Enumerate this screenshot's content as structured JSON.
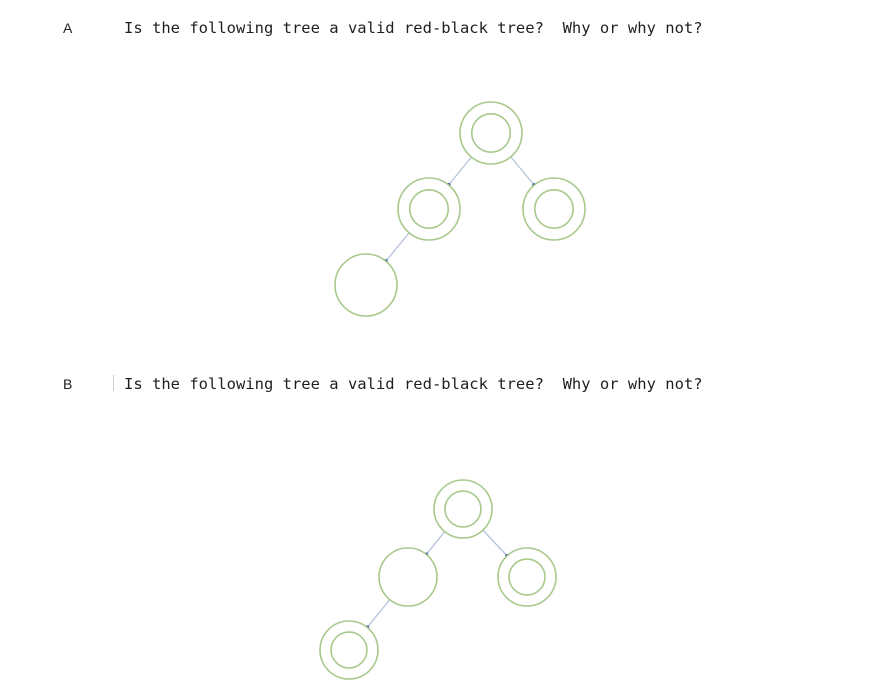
{
  "questions": [
    {
      "label": "A",
      "text": "Is the following tree a valid red-black tree?  Why or why not?",
      "tree": {
        "nodes": [
          {
            "id": "root",
            "style": "double"
          },
          {
            "id": "left",
            "style": "double",
            "parent": "root"
          },
          {
            "id": "right",
            "style": "double",
            "parent": "root"
          },
          {
            "id": "left-left",
            "style": "single",
            "parent": "left"
          }
        ]
      }
    },
    {
      "label": "B",
      "text": "Is the following tree a valid red-black tree?  Why or why not?",
      "tree": {
        "nodes": [
          {
            "id": "root",
            "style": "double"
          },
          {
            "id": "left",
            "style": "single",
            "parent": "root"
          },
          {
            "id": "right",
            "style": "double",
            "parent": "root"
          },
          {
            "id": "left-left",
            "style": "double",
            "parent": "left"
          }
        ]
      }
    }
  ],
  "colors": {
    "node_stroke": "#a8c98c",
    "edge": "#b5c3dc",
    "arrowhead": "#3b5ba8"
  }
}
